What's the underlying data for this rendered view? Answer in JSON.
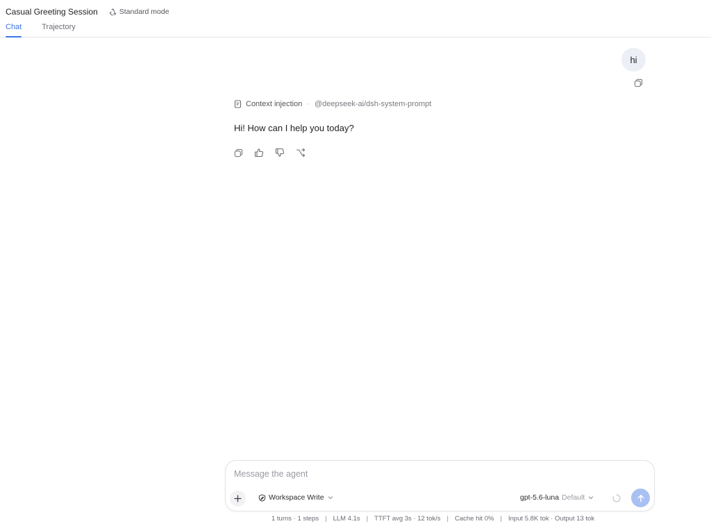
{
  "header": {
    "session_title": "Casual Greeting Session",
    "mode_label": "Standard mode",
    "mode_icon": "recycle-icon",
    "tabs": [
      {
        "label": "Chat",
        "active": true
      },
      {
        "label": "Trajectory",
        "active": false
      }
    ]
  },
  "conversation": {
    "user_message": "hi",
    "context_label": "Context injection",
    "context_separator": "·",
    "context_ref": "@deepseek-ai/dsh-system-prompt",
    "assistant_message": "Hi! How can I help you today?",
    "message_actions": [
      "copy-icon",
      "thumbs-up-icon",
      "thumbs-down-icon",
      "branch-icon"
    ]
  },
  "composer": {
    "placeholder": "Message the agent",
    "value": "",
    "workspace_label": "Workspace Write",
    "model_name": "gpt-5.6-luna",
    "model_tag": "Default"
  },
  "stats": {
    "turns": "1 turns · 1 steps",
    "llm": "LLM 4.1s",
    "ttft": "TTFT avg 3s · 12 tok/s",
    "cache": "Cache hit 0%",
    "tokens": "Input 5.8K tok · Output 13 tok",
    "separator": "|"
  },
  "colors": {
    "accent": "#3d73e8",
    "user_bubble": "#eceff6",
    "send_button": "#a9c0f2",
    "border": "#e6e6ea"
  }
}
